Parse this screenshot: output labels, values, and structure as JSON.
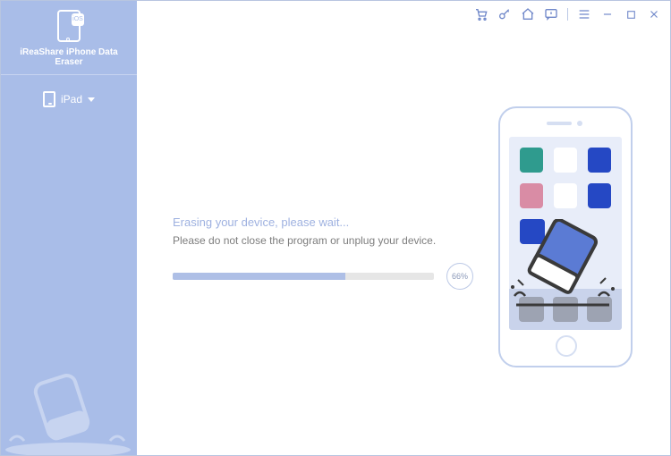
{
  "brand": {
    "title": "iReaShare iPhone Data Eraser",
    "badge": "iOS"
  },
  "sidebar": {
    "device_name": "iPad"
  },
  "titlebar": {
    "cart": "cart-icon",
    "key": "key-icon",
    "home": "home-icon",
    "feedback": "feedback-icon",
    "menu": "menu-icon",
    "minimize": "minimize-icon",
    "maximize": "maximize-icon",
    "close": "close-icon"
  },
  "progress": {
    "line1": "Erasing your device, please wait...",
    "line2": "Please do not close the program or unplug your device.",
    "percent_value": 66,
    "percent_label": "66%"
  }
}
